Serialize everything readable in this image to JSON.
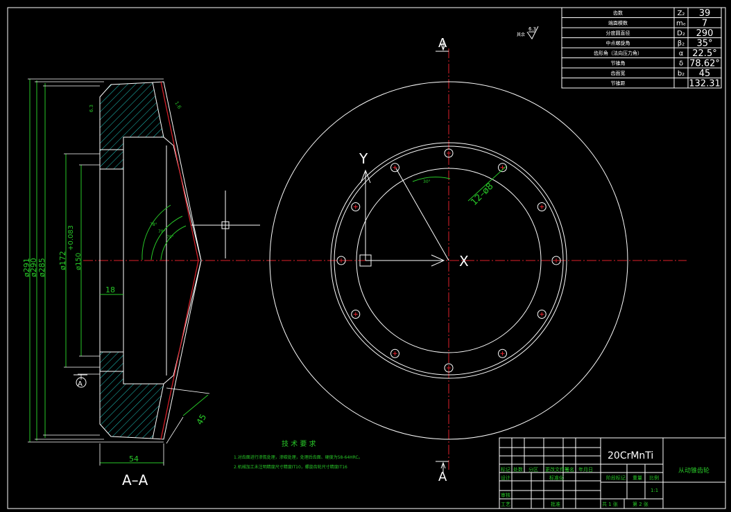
{
  "params": [
    {
      "name": "齿数",
      "sym": "Z₂",
      "val": "39"
    },
    {
      "name": "端面模数",
      "sym": "mₑ",
      "val": "7"
    },
    {
      "name": "分度圆直径",
      "sym": "D₂",
      "val": "290"
    },
    {
      "name": "中点螺旋角",
      "sym": "β₂",
      "val": "35°"
    },
    {
      "name": "齿形角（法向压力角）",
      "sym": "α",
      "val": "22.5°"
    },
    {
      "name": "节锥角",
      "sym": "δ",
      "val": "78.62°"
    },
    {
      "name": "齿面宽",
      "sym": "b₂",
      "val": "45"
    },
    {
      "name": "节锥距",
      "sym": "",
      "val": "132.31"
    }
  ],
  "surface_roughness": {
    "label": "其余",
    "value": "6.3"
  },
  "section_labels": {
    "cut_a": "A",
    "view": "A–A",
    "marker": "A"
  },
  "dims": {
    "d291": "ø291",
    "d290": "ø290",
    "d285": "ø285",
    "d172": "ø172",
    "d150": "ø150",
    "tol_up": "+0.083",
    "tol_dn": "+0.043",
    "hub": "18",
    "width": "54",
    "face": "45",
    "ang1": "78°",
    "ang2": "79°",
    "ang3": "79°",
    "tilt": "1.6",
    "rough": "6.3"
  },
  "axes": {
    "y": "Y",
    "x": "X"
  },
  "holes": {
    "label": "12–ø8",
    "angle": "30°"
  },
  "notes": {
    "title": "技 术 要 求",
    "lines": [
      "1.对齿面进行渗氮处理，渗碳处理，处理后齿面、硬度为58-64HRC。",
      "2.机械加工未注明精度尺寸精度IT10，螺旋齿轮尺寸精度IT16"
    ]
  },
  "title_block": {
    "material": "20CrMnTi",
    "part_name": "从动锥齿轮",
    "rev_header": [
      "标记",
      "处数",
      "分区",
      "更改文件号",
      "签名",
      "年月日"
    ],
    "design": "设计",
    "std": "标准化",
    "review": "审核",
    "process": "工艺",
    "approve": "批准",
    "stage": "阶段标记",
    "weight": "重量",
    "scale": "比例",
    "scale_val": "1:1",
    "sheets": "共 1 张",
    "sheet": "第 2 张"
  }
}
